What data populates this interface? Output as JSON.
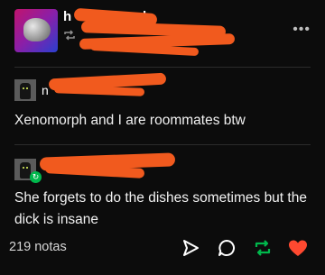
{
  "header": {
    "blog_name": "h",
    "blog_name_tail": "k",
    "reblog_icon": "reblog-icon",
    "more_icon": "more-icon",
    "more_label": "•••"
  },
  "posts": [
    {
      "author": "n",
      "text": "Xenomorph and I are roommates btw"
    },
    {
      "author": "",
      "text": "She forgets to do the dishes sometimes but the dick is insane"
    }
  ],
  "footer": {
    "notes": "219 notas",
    "icons": [
      "share-icon",
      "reply-icon",
      "reblog-icon",
      "like-icon"
    ],
    "colors": {
      "reblog": "#00b84c",
      "like": "#ff4930",
      "redaction": "#f15a1e"
    }
  }
}
